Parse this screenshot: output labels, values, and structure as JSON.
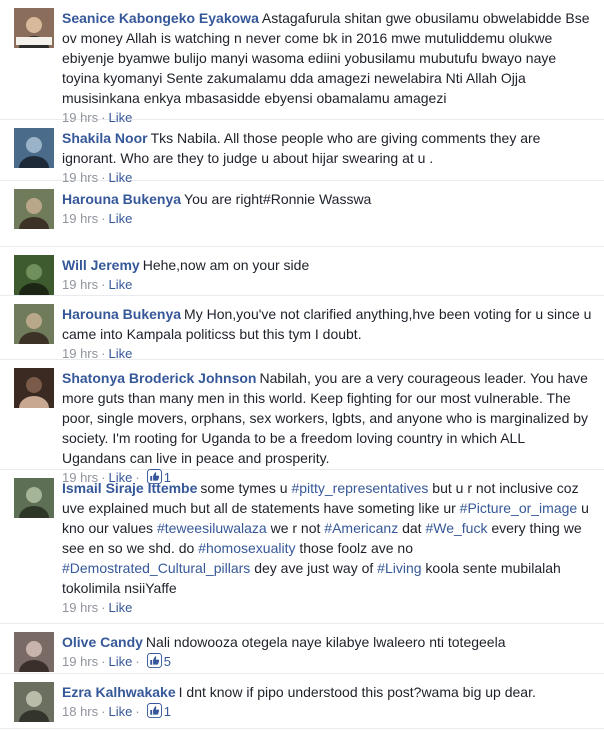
{
  "comments": [
    {
      "author": "Seanice Kabongeko Eyakowa",
      "segments": [
        {
          "t": "Astagafurula shitan gwe obusilamu obwelabidde Bse ov money Allah is watching n never come bk in 2016 mwe mutuliddemu olukwe ebiyenje byamwe bulijo manyi wasoma ediini yobusilamu mubutufu bwayo naye toyina kyomanyi Sente zakumalamu dda amagezi newelabira Nti Allah Ojja musisinkana enkya mbasasidde ebyensi obamalamu amagezi",
          "tag": false
        }
      ],
      "time": "19 hrs",
      "like": "Like",
      "reactions": ""
    },
    {
      "author": "Shakila Noor",
      "segments": [
        {
          "t": "Tks Nabila. All those people who are giving comments they are ignorant. Who are they to judge u about hijar swearing at u .",
          "tag": false
        }
      ],
      "time": "19 hrs",
      "like": "Like",
      "reactions": ""
    },
    {
      "author": "Harouna Bukenya",
      "segments": [
        {
          "t": "You are right#Ronnie Wasswa",
          "tag": false
        }
      ],
      "time": "19 hrs",
      "like": "Like",
      "reactions": ""
    },
    {
      "author": "Will Jeremy",
      "segments": [
        {
          "t": "Hehe,now am on your side",
          "tag": false
        }
      ],
      "time": "19 hrs",
      "like": "Like",
      "reactions": ""
    },
    {
      "author": "Harouna Bukenya",
      "segments": [
        {
          "t": "My Hon,you've not clarified anything,hve been voting for u since u came into Kampala politicss but this tym I doubt.",
          "tag": false
        }
      ],
      "time": "19 hrs",
      "like": "Like",
      "reactions": ""
    },
    {
      "author": "Shatonya Broderick Johnson",
      "segments": [
        {
          "t": "Nabilah, you are a very courageous leader. You have more guts than many men in this world. Keep fighting for our most vulnerable. The poor, single movers, orphans, sex workers, lgbts, and anyone who is marginalized by society. I'm rooting for Uganda to be a freedom loving country in which ALL Ugandans can live in peace and prosperity.",
          "tag": false
        }
      ],
      "time": "19 hrs",
      "like": "Like",
      "reactions": "1"
    },
    {
      "author": "Ismail Siraje Ittembe",
      "segments": [
        {
          "t": "some tymes u ",
          "tag": false
        },
        {
          "t": "#pitty_representatives",
          "tag": true
        },
        {
          "t": " but u r not inclusive coz uve explained much but all de statements have someting like ur ",
          "tag": false
        },
        {
          "t": "#Picture_or_image",
          "tag": true
        },
        {
          "t": " u kno our values ",
          "tag": false
        },
        {
          "t": "#teweesiluwalaza",
          "tag": true
        },
        {
          "t": " we r not ",
          "tag": false
        },
        {
          "t": "#Americanz",
          "tag": true
        },
        {
          "t": " dat ",
          "tag": false
        },
        {
          "t": "#We_fuck",
          "tag": true
        },
        {
          "t": " every thing we see en so we shd. do ",
          "tag": false
        },
        {
          "t": "#homosexuality",
          "tag": true
        },
        {
          "t": " those foolz ave no ",
          "tag": false
        },
        {
          "t": "#Demostrated_Cultural_pillars",
          "tag": true
        },
        {
          "t": " dey ave just way of ",
          "tag": false
        },
        {
          "t": "#Living",
          "tag": true
        },
        {
          "t": " koola sente mubilalah tokolimila nsiiYaffe",
          "tag": false
        }
      ],
      "time": "19 hrs",
      "like": "Like",
      "reactions": ""
    },
    {
      "author": "Olive Candy",
      "segments": [
        {
          "t": "Nali ndowooza otegela naye kilabye lwaleero nti totegeela",
          "tag": false
        }
      ],
      "time": "19 hrs",
      "like": "Like",
      "reactions": "5"
    },
    {
      "author": "Ezra Kalhwakake",
      "segments": [
        {
          "t": "I dnt know if pipo understood this post?wama big up dear.",
          "tag": false
        }
      ],
      "time": "18 hrs",
      "like": "Like",
      "reactions": "1"
    }
  ],
  "colors": {
    "link": "#365899",
    "text": "#1d2129",
    "meta": "#90949c",
    "divider": "#e9ebee"
  },
  "icons": {
    "reaction": "thumbs-up-icon"
  }
}
